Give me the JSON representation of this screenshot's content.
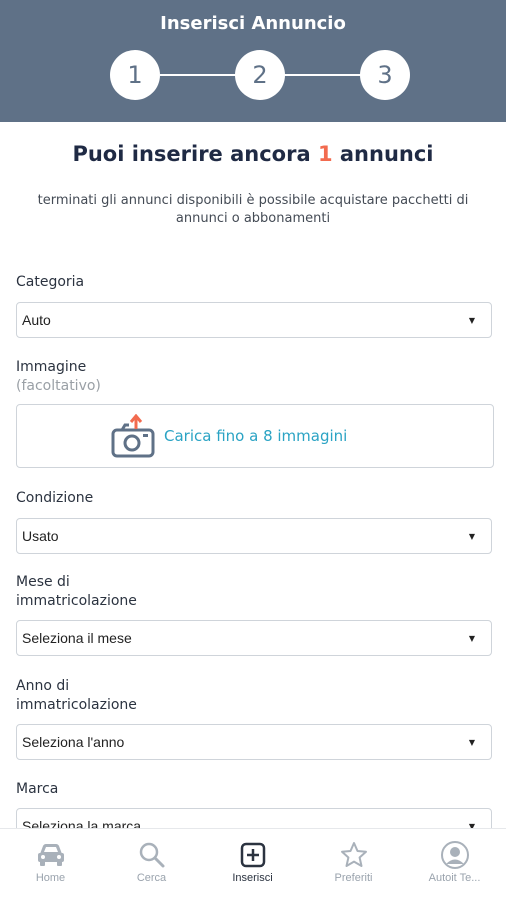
{
  "header": {
    "title": "Inserisci Annuncio",
    "steps": [
      "1",
      "2",
      "3"
    ]
  },
  "quota": {
    "prefix": "Puoi inserire ancora",
    "count": "1",
    "suffix": "annunci",
    "count_color": "#f26b4f"
  },
  "note": "terminati gli annunci disponibili è possibile acquistare pacchetti di annunci o abbonamenti",
  "form": {
    "categoria": {
      "label": "Categoria",
      "value": "Auto"
    },
    "immagine": {
      "label": "Immagine",
      "optional": "(facoltativo)",
      "upload_text": "Carica fino a 8 immagini",
      "icon": "camera-upload-icon"
    },
    "condizione": {
      "label": "Condizione",
      "value": "Usato"
    },
    "mese": {
      "label_line1": "Mese di",
      "label_line2": "immatricolazione",
      "value": "Seleziona il mese"
    },
    "anno": {
      "label_line1": "Anno di",
      "label_line2": "immatricolazione",
      "value": "Seleziona l'anno"
    },
    "marca": {
      "label": "Marca",
      "value": "Seleziona la marca"
    }
  },
  "tabbar": {
    "items": [
      {
        "label": "Home",
        "icon": "car-icon"
      },
      {
        "label": "Cerca",
        "icon": "search-icon"
      },
      {
        "label": "Inserisci",
        "icon": "add-square-icon",
        "active": true
      },
      {
        "label": "Preferiti",
        "icon": "star-icon"
      },
      {
        "label": "Autoit Te...",
        "icon": "user-icon"
      }
    ]
  },
  "colors": {
    "header_bg": "#5f7187",
    "accent_link": "#2aa3c4",
    "accent_orange": "#f26b4f"
  }
}
